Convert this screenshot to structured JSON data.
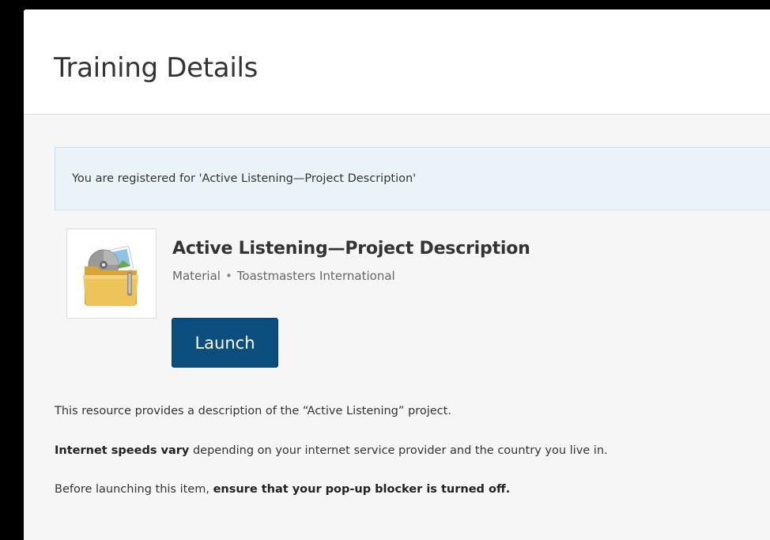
{
  "header": {
    "title": "Training Details"
  },
  "alert": {
    "text": "You are registered for 'Active Listening—Project Description'"
  },
  "item": {
    "title": "Active Listening—Project Description",
    "type": "Material",
    "separator": "•",
    "provider": "Toastmasters International",
    "thumbnail_icon": "material-folder-icon",
    "launch_label": "Launch"
  },
  "description": {
    "line1": "This resource provides a description of the “Active Listening” project.",
    "line2_bold": "Internet speeds vary",
    "line2_rest": " depending on your internet service provider and the country you live in.",
    "line3_start": "Before launching this item, ",
    "line3_bold": "ensure that your pop-up blocker is turned off."
  },
  "colors": {
    "accent": "#0c4f7e",
    "alert_bg": "#eaf4f8",
    "alert_border": "#c9e2ec",
    "folder": "#e8b94a"
  }
}
